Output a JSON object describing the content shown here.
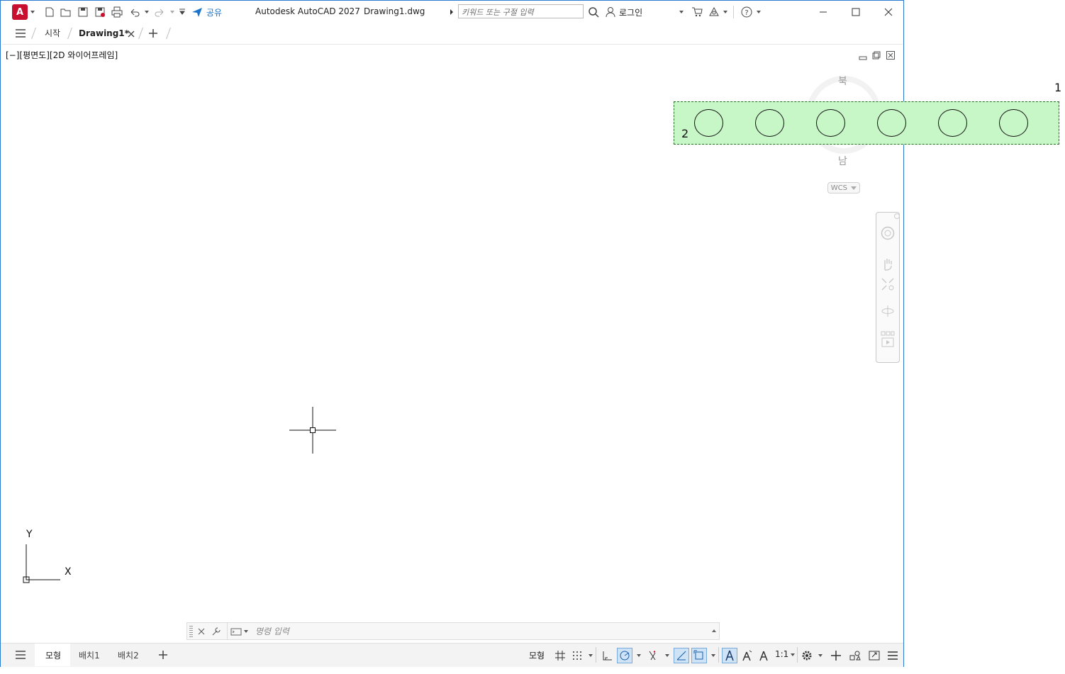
{
  "title_bar": {
    "app_letter": "A",
    "share_label": "공유",
    "app_title": "Autodesk AutoCAD 2027",
    "file_name": "Drawing1.dwg",
    "search_placeholder": "키워드 또는 구절 입력",
    "login_label": "로그인"
  },
  "doc_tabs": {
    "start_label": "시작",
    "active_label": "Drawing1*"
  },
  "viewport": {
    "label": "[−][평면도][2D 와이어프레임]",
    "compass_north": "북",
    "compass_south": "남",
    "wcs_label": "WCS",
    "ucs_x": "X",
    "ucs_y": "Y"
  },
  "command_line": {
    "placeholder": "명령 입력"
  },
  "overlay": {
    "label_outer": "1",
    "label_inner": "2",
    "circle_count": 6,
    "fill_color": "#c7f6c7"
  },
  "layout_tabs": [
    "모형",
    "배치1",
    "배치2"
  ],
  "status_bar": {
    "model_label": "모형",
    "scale_label": "1:1"
  },
  "colors": {
    "accent": "#2b7bd0",
    "app_icon": "#c8102e",
    "share": "#1a73c8"
  }
}
